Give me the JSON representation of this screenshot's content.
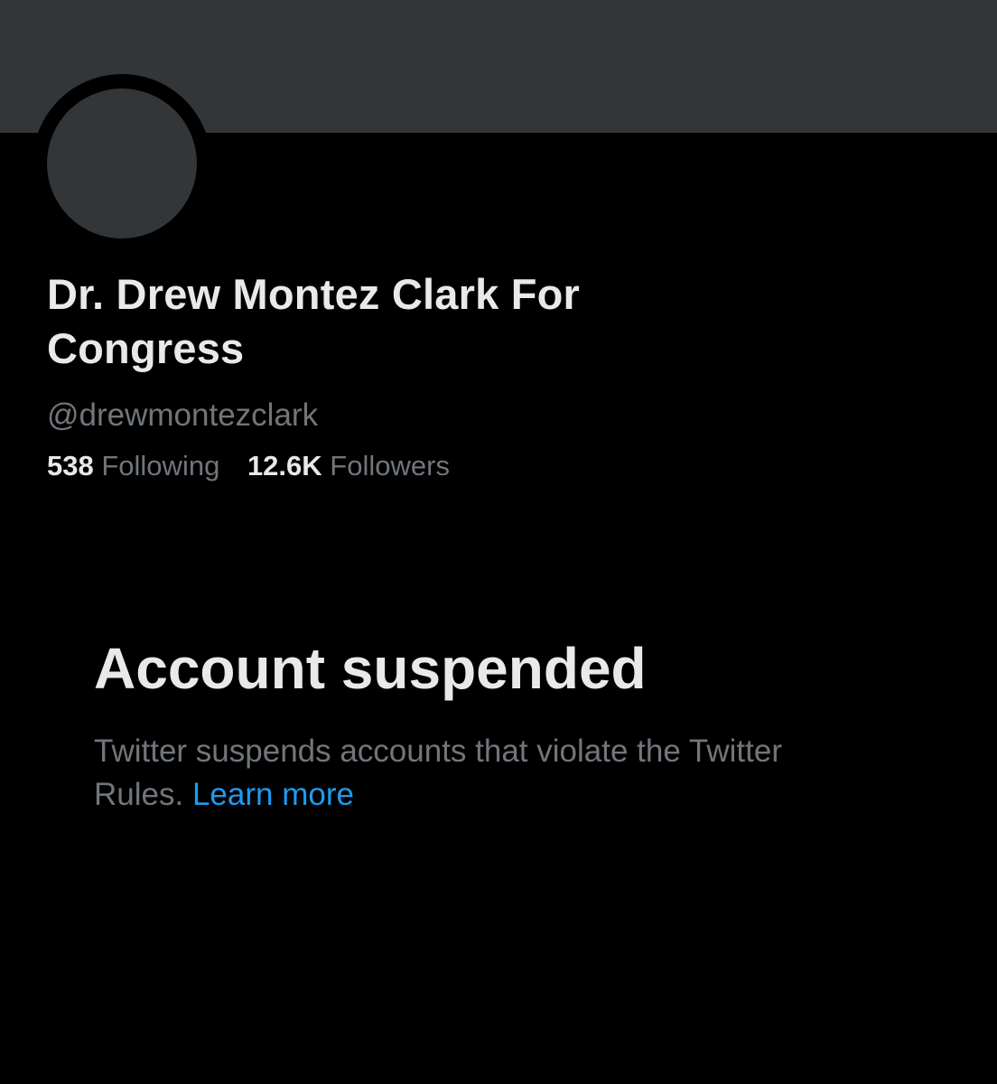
{
  "profile": {
    "display_name": "Dr. Drew Montez Clark For Congress",
    "handle": "@drewmontezclark",
    "following_count": "538",
    "following_label": "Following",
    "followers_count": "12.6K",
    "followers_label": "Followers"
  },
  "notice": {
    "title": "Account suspended",
    "body": "Twitter suspends accounts that violate the Twitter Rules.",
    "link_label": "Learn more"
  },
  "colors": {
    "background": "#000000",
    "banner": "#333639",
    "primary_text": "#e7e9ea",
    "secondary_text": "#71767b",
    "link": "#1d9bf0"
  }
}
